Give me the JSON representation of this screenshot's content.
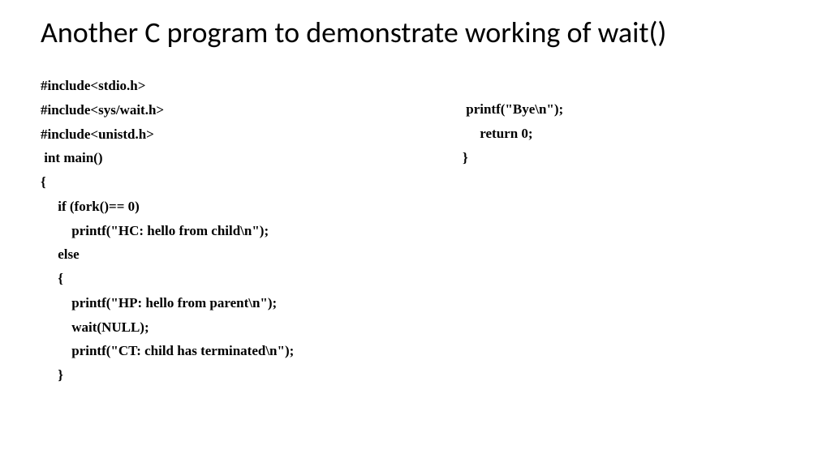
{
  "title": "Another C program to demonstrate working of wait()",
  "left_code": {
    "l0": "#include<stdio.h>",
    "l1": "#include<sys/wait.h>",
    "l2": "#include<unistd.h>",
    "l3": " int main()",
    "l4": "{",
    "l5": "     if (fork()== 0)",
    "l6": "         printf(\"HC: hello from child\\n\");",
    "l7": "     else",
    "l8": "     {",
    "l9": "         printf(\"HP: hello from parent\\n\");",
    "l10": "         wait(NULL);",
    "l11": "         printf(\"CT: child has terminated\\n\");",
    "l12": "     }"
  },
  "right_code": {
    "r0": " printf(\"Bye\\n\");",
    "r1": "     return 0;",
    "r2": "}"
  }
}
